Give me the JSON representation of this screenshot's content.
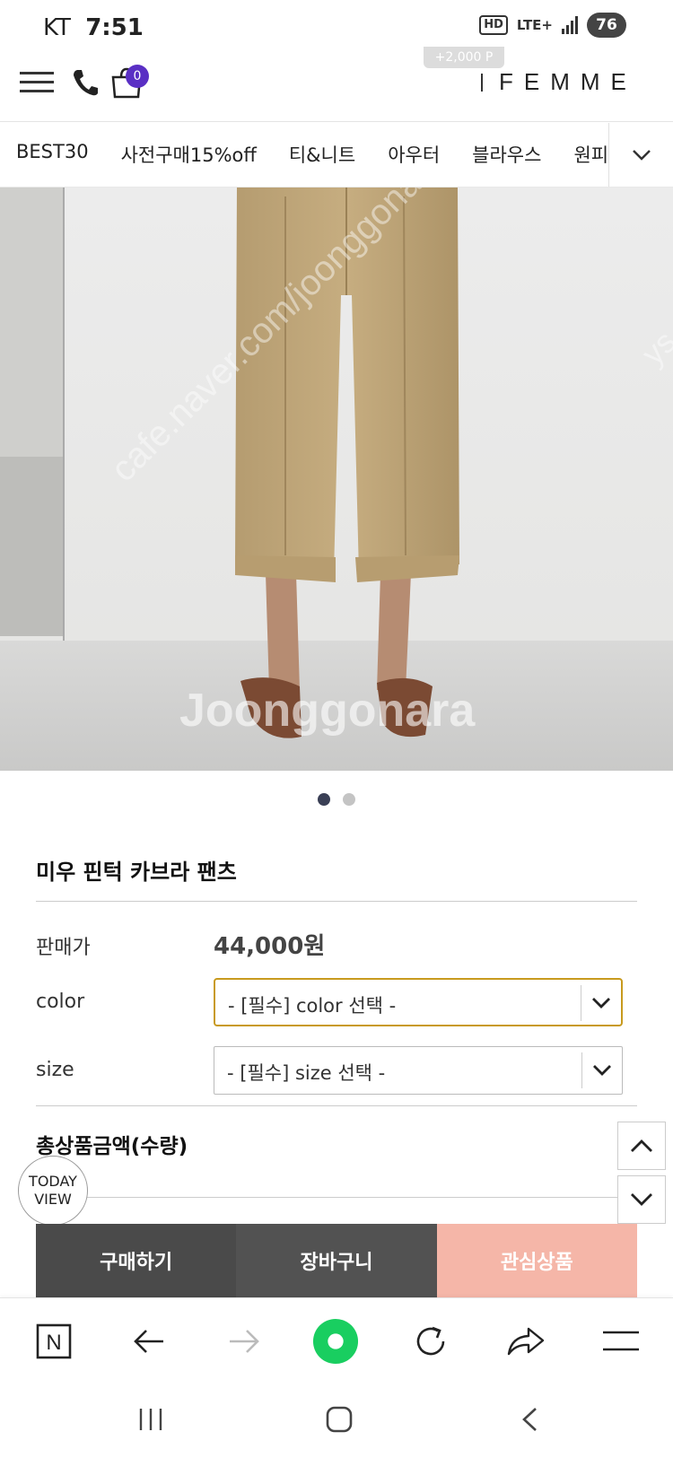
{
  "status_bar": {
    "carrier": "KT",
    "time": "7:51",
    "hd_label": "HD",
    "network_label": "LTE+",
    "battery": "76"
  },
  "header": {
    "cart_count": "0",
    "points_chip": "+2,000 P",
    "logo": "FEMME"
  },
  "categories": {
    "items": [
      "BEST30",
      "사전구매15%off",
      "티&니트",
      "아우터",
      "블라우스",
      "원피"
    ]
  },
  "product": {
    "image_watermarks": [
      "cafe.naver.com/joonggonara",
      "Joonggonara",
      "ys"
    ],
    "pager": {
      "total": 2,
      "active_index": 0
    },
    "title": "미우 핀턱 카브라 팬츠",
    "price_label": "판매가",
    "price_value": "44,000원",
    "color_label": "color",
    "color_select": "- [필수] color 선택 -",
    "size_label": "size",
    "size_select": "- [필수] size 선택 -",
    "total_label": "총상품금액(수량)"
  },
  "floating": {
    "today_view_line1": "TODAY",
    "today_view_line2": "VIEW"
  },
  "actions": {
    "buy": "구매하기",
    "cart": "장바구니",
    "wishlist": "관심상품"
  },
  "browser_toolbar": {
    "home_letter": "N"
  },
  "colors": {
    "accent_purple": "#5a2fc4",
    "select_focus": "#c89a1e",
    "wishlist_pink": "#f5b6a8",
    "naver_green": "#19ce60",
    "pager_active": "#3a3f55"
  }
}
